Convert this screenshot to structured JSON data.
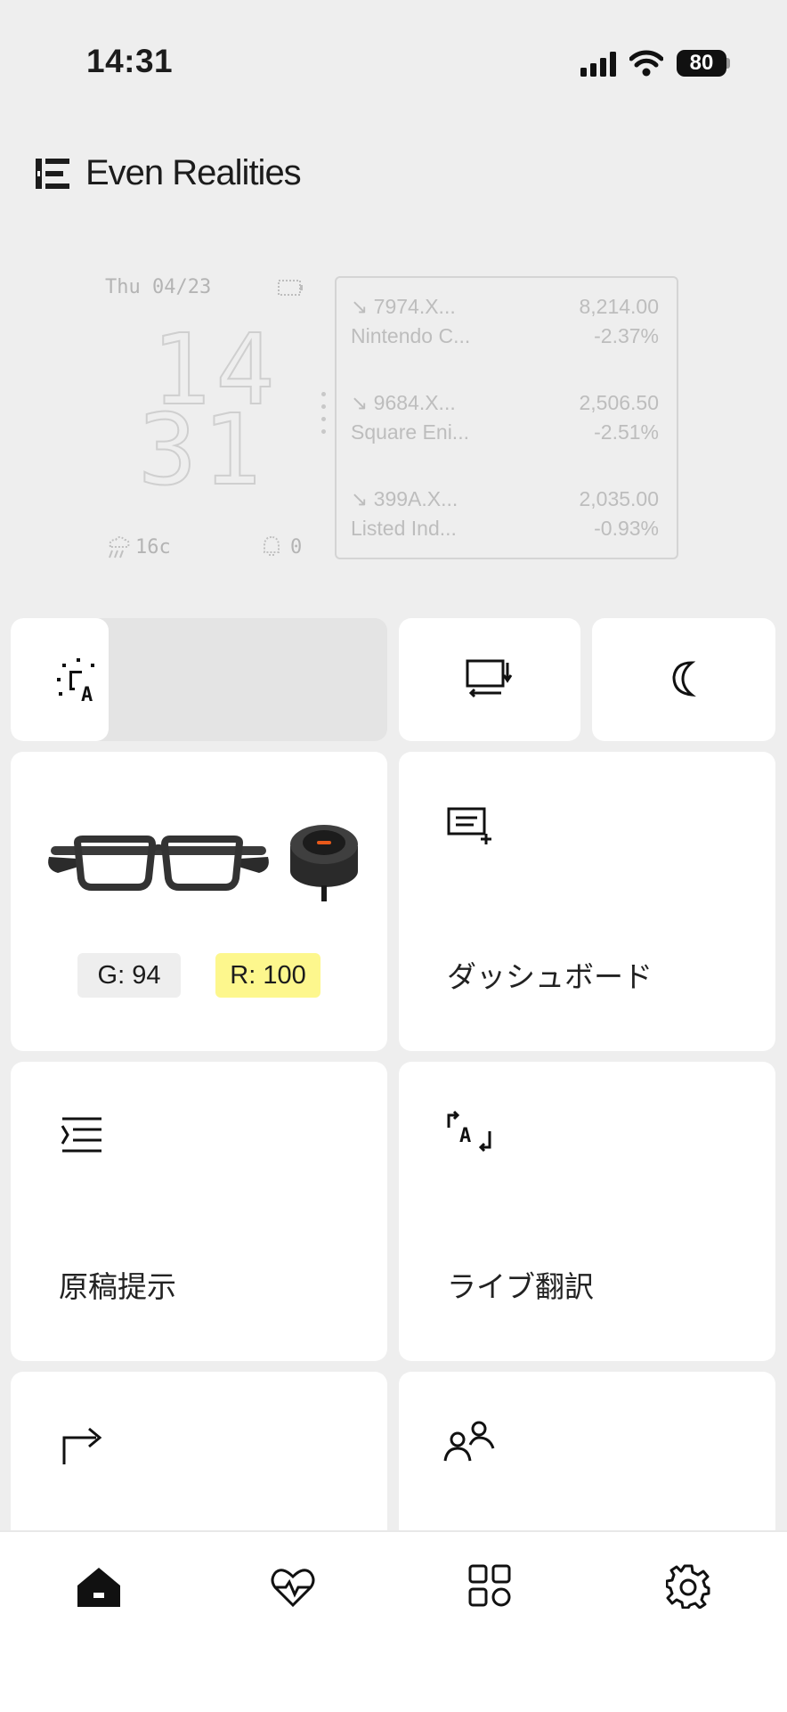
{
  "status_bar": {
    "time": "14:31",
    "battery": "80"
  },
  "header": {
    "title": "Even Realities",
    "menu_icon": "menu-icon"
  },
  "glasses_preview": {
    "date": "Thu 04/23",
    "hour": "14",
    "minute": "31",
    "weather": "16c",
    "notifications": "0",
    "stocks": [
      {
        "symbol": "↘ 7974.X...",
        "price": "8,214.00",
        "name": "Nintendo C...",
        "change": "-2.37%"
      },
      {
        "symbol": "↘ 9684.X...",
        "price": "2,506.50",
        "name": "Square Eni...",
        "change": "-2.51%"
      },
      {
        "symbol": "↘ 399A.X...",
        "price": "2,035.00",
        "name": "Listed Ind...",
        "change": "-0.93%"
      }
    ]
  },
  "controls": {
    "brightness_level": 0.26,
    "brightness_icon": "brightness-auto-icon",
    "display_icon": "display-icon",
    "silent_icon": "moon-icon"
  },
  "device": {
    "left_battery": "G: 94",
    "right_battery": "R: 100"
  },
  "features": {
    "dashboard": "ダッシュボード",
    "teleprompter": "原稿提示",
    "translate": "ライブ翻訳"
  },
  "tabs": [
    "home-icon",
    "health-icon",
    "apps-icon",
    "settings-icon"
  ],
  "colors": {
    "accent_yellow": "#fdf78d",
    "badge_gray": "#eeeeee",
    "orange": "#e8591a"
  }
}
